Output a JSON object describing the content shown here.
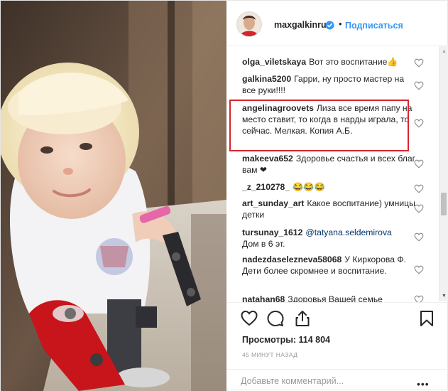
{
  "header": {
    "username": "maxgalkinru",
    "separator": "•",
    "follow_label": "Подписаться"
  },
  "comments": [
    {
      "user": "olga_viletskaya",
      "text": "Вот это воспитание👍"
    },
    {
      "user": "galkina5200",
      "text": "Гарри, ну просто мастер на все руки!!!!"
    },
    {
      "user": "angelinagroovets",
      "text": "Лиза все время папу на место ставит, то когда в нарды играла, то сейчас. Мелкая. Копия А.Б."
    },
    {
      "user": "makeeva652",
      "text": "Здоровье счастья и всех благ вам ❤"
    },
    {
      "user": "_z_210278_",
      "text": "😂😂😂"
    },
    {
      "user": "art_sunday_art",
      "text": "Какое воспитание) умницы детки"
    },
    {
      "user": "tursunay_1612",
      "mention": "@tatyana.seldemirova",
      "text": "Дом в 6 эт."
    },
    {
      "user": "nadezdaselezneva58068",
      "text": "У Киркорова Ф. Дети более скромнее и воспитание."
    },
    {
      "user": "natahan68",
      "text": "Здоровья Вашей семье"
    }
  ],
  "views": {
    "label": "Просмотры:",
    "count": "114 804"
  },
  "time_ago": "45 МИНУТ НАЗАД",
  "add_comment": {
    "placeholder": "Добавьте комментарий..."
  },
  "more_label": "•••",
  "colors": {
    "accent": "#3897f0",
    "highlight": "#d8262f",
    "text": "#262626",
    "muted": "#999999"
  },
  "icons": [
    "verified-badge-icon",
    "heart-icon",
    "comment-icon",
    "share-icon",
    "bookmark-icon"
  ]
}
